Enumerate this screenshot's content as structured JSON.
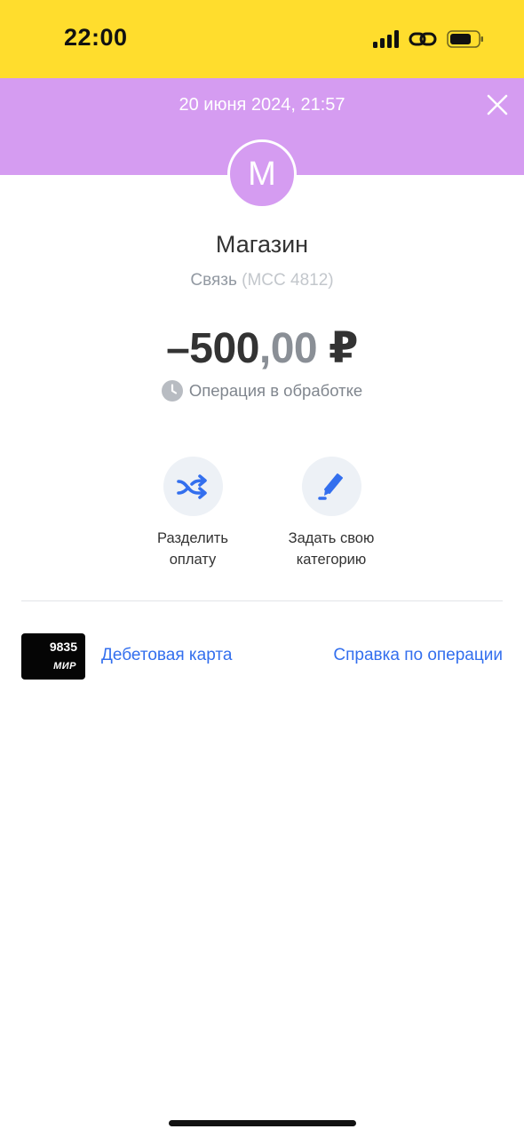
{
  "status_bar": {
    "time": "22:00",
    "icons": [
      "cellular-signal-icon",
      "link-icon",
      "battery-icon"
    ],
    "background": "#FFDD2D"
  },
  "header": {
    "datetime": "20 июня 2024, 21:57",
    "close_icon": "close-icon",
    "background": "#D59CF1"
  },
  "merchant": {
    "avatar_letter": "М",
    "name": "Магазин",
    "category": "Связь",
    "mcc": "(MCC 4812)"
  },
  "transaction": {
    "amount_int": "–500",
    "amount_frac": ",00",
    "currency": "₽",
    "status": "Операция в обработке",
    "status_icon": "clock-icon"
  },
  "actions": [
    {
      "id": "split",
      "label_line1": "Разделить",
      "label_line2": "оплату",
      "icon": "split-arrows-icon"
    },
    {
      "id": "category",
      "label_line1": "Задать свою",
      "label_line2": "категорию",
      "icon": "pen-icon"
    }
  ],
  "card": {
    "last_digits": "9835",
    "network": "МИР",
    "link_label": "Дебетовая карта"
  },
  "help": {
    "label": "Справка по операции"
  },
  "colors": {
    "accent_blue": "#336FEE",
    "action_bg": "#EDF1F6",
    "purple": "#D59CF1",
    "yellow": "#FFDD2D"
  }
}
